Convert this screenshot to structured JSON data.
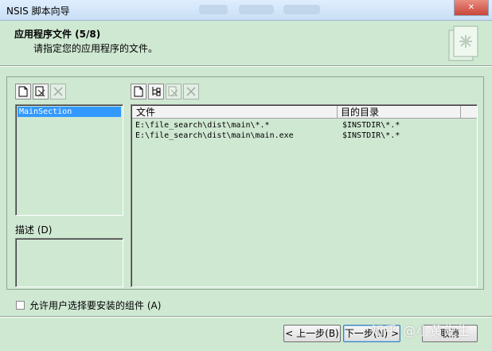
{
  "window": {
    "title": "NSIS 脚本向导",
    "close_label": "✕"
  },
  "header": {
    "title": "应用程序文件 (5/8)",
    "subtitle": "请指定您的应用程序的文件。"
  },
  "sections": {
    "items": [
      "MainSection"
    ]
  },
  "description": {
    "label": "描述 (D)"
  },
  "files": {
    "columns": [
      "文件",
      "目的目录"
    ],
    "rows": [
      {
        "path": "E:\\file_search\\dist\\main\\*.*",
        "dest": "$INSTDIR\\*.*"
      },
      {
        "path": "E:\\file_search\\dist\\main\\main.exe",
        "dest": "$INSTDIR\\*.*"
      }
    ]
  },
  "options": {
    "allow_select_label": "允许用户选择要安装的组件 (A)"
  },
  "buttons": {
    "back": "< 上一步(B)",
    "next": "下一步(N) >",
    "cancel": "取消"
  },
  "watermark": "知乎 @小黄先生"
}
